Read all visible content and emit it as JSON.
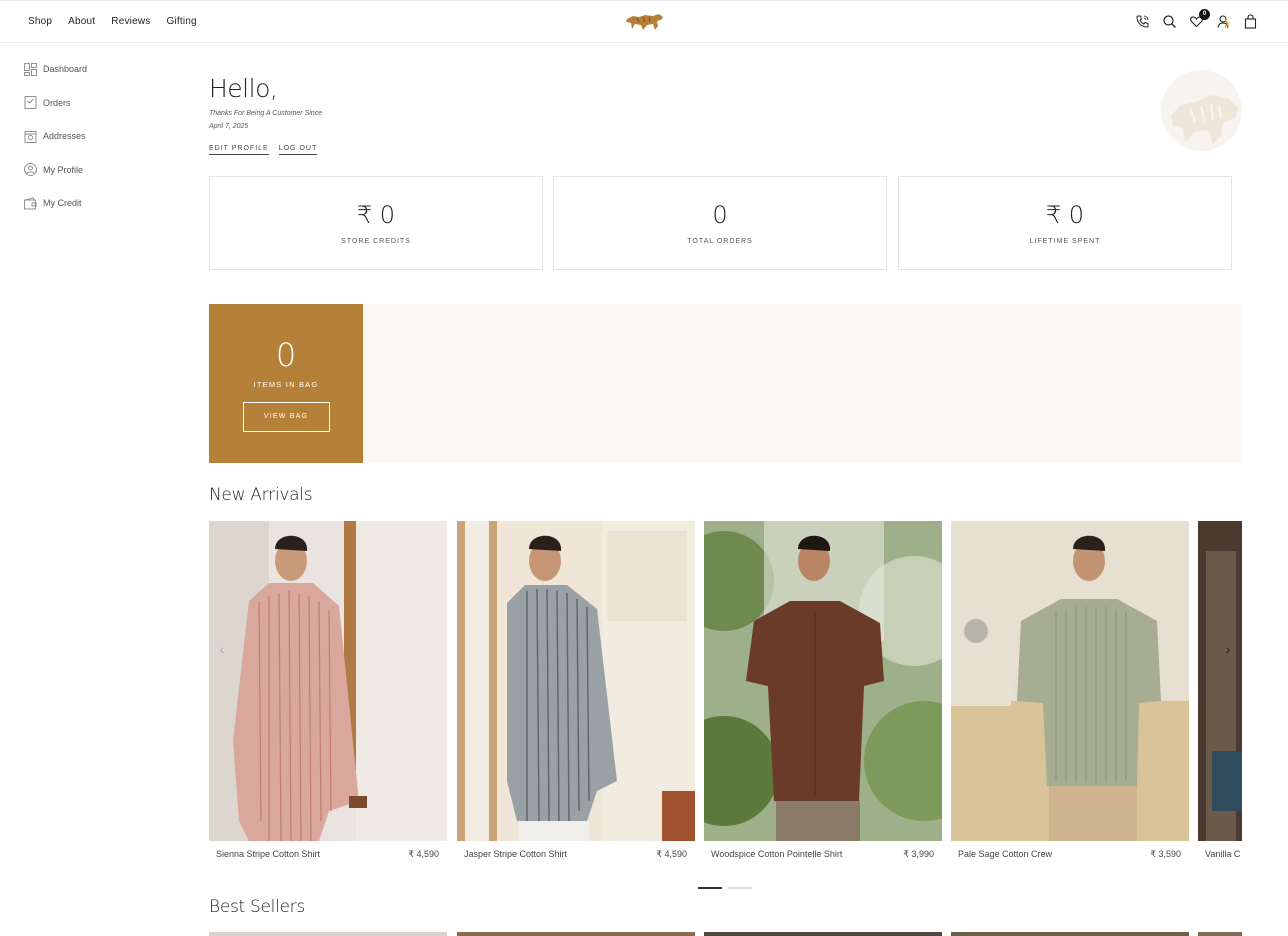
{
  "header": {
    "nav": [
      "Shop",
      "About",
      "Reviews",
      "Gifting"
    ],
    "wishlist_count": "0",
    "icons": [
      "phone-icon",
      "search-icon",
      "heart-icon",
      "user-icon",
      "bag-icon"
    ],
    "accent": "#b58038"
  },
  "sidebar": {
    "items": [
      {
        "label": "Dashboard",
        "icon": "dashboard-icon"
      },
      {
        "label": "Orders",
        "icon": "orders-icon"
      },
      {
        "label": "Addresses",
        "icon": "addresses-icon"
      },
      {
        "label": "My Profile",
        "icon": "profile-icon"
      },
      {
        "label": "My Credit",
        "icon": "wallet-icon"
      }
    ]
  },
  "greeting": {
    "hello": "Hello,",
    "since_line1": "Thanks For Being A Customer Since",
    "since_line2": "April 7, 2025",
    "edit_profile": "EDIT PROFILE",
    "log_out": "LOG OUT"
  },
  "stats": [
    {
      "value": "₹ 0",
      "label": "STORE CREDITS"
    },
    {
      "value": "0",
      "label": "TOTAL ORDERS"
    },
    {
      "value": "₹ 0",
      "label": "LIFETIME SPENT"
    }
  ],
  "bag": {
    "count": "0",
    "label": "ITEMS IN BAG",
    "button": "VIEW BAG"
  },
  "new_arrivals": {
    "title": "New Arrivals",
    "products": [
      {
        "name": "Sienna Stripe Cotton Shirt",
        "price": "₹ 4,590"
      },
      {
        "name": "Jasper Stripe Cotton Shirt",
        "price": "₹ 4,590"
      },
      {
        "name": "Woodspice Cotton Pointelle Shirt",
        "price": "₹ 3,990"
      },
      {
        "name": "Pale Sage Cotton Crew",
        "price": "₹ 3,590"
      },
      {
        "name": "Vanilla C",
        "price": ""
      }
    ]
  },
  "best_sellers": {
    "title": "Best Sellers"
  }
}
